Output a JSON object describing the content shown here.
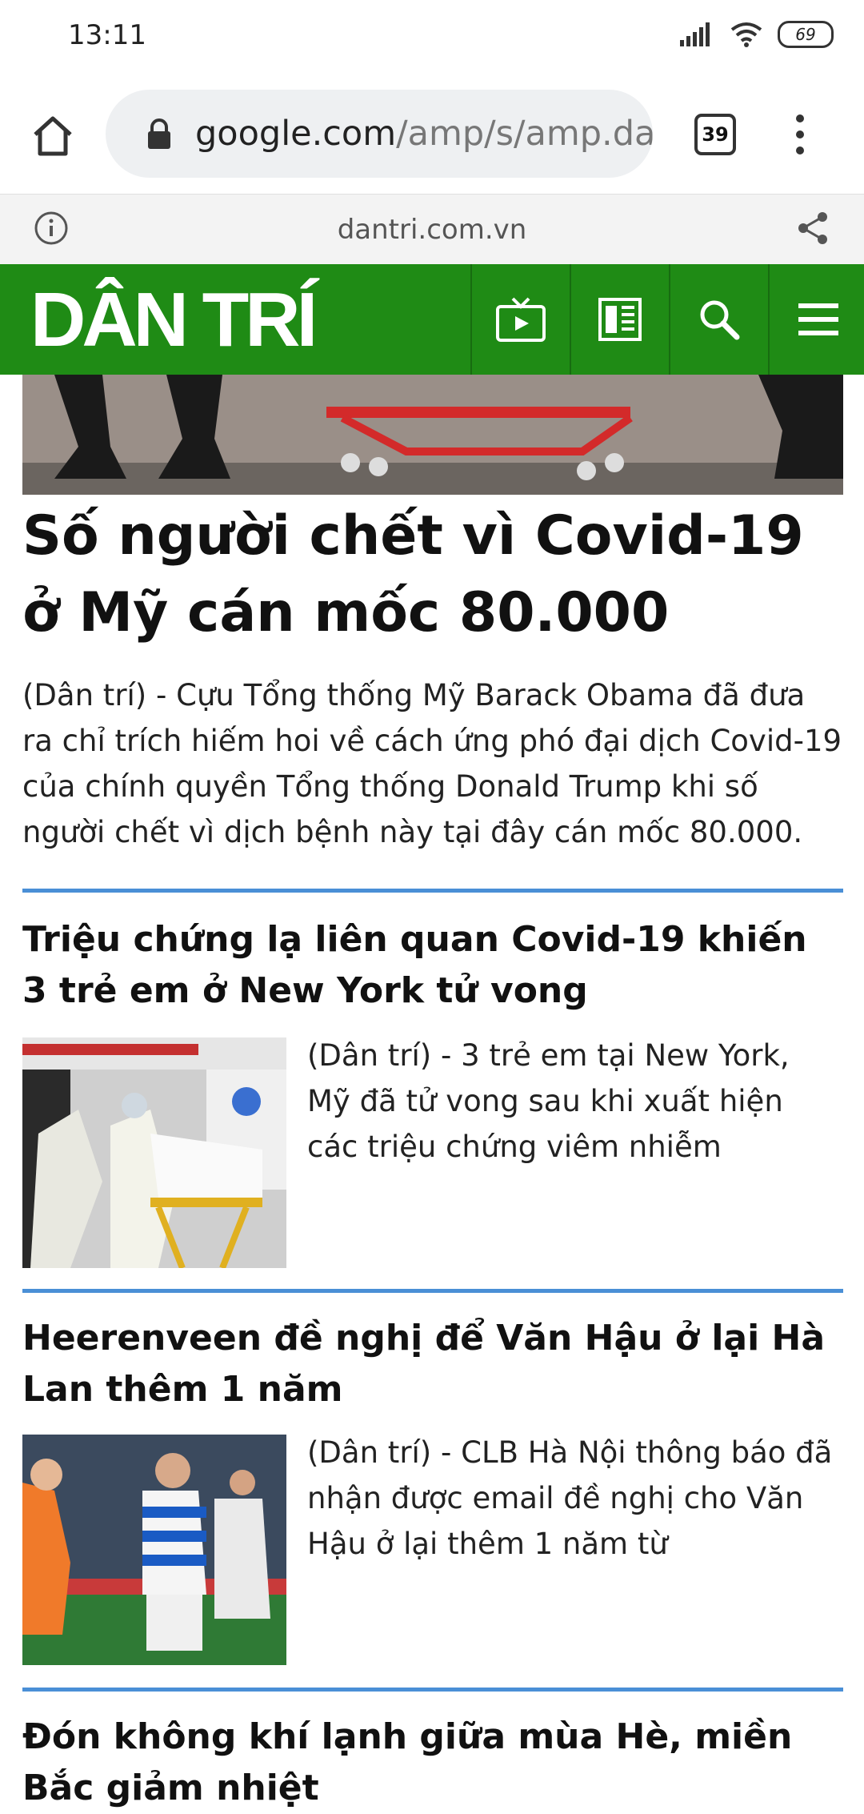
{
  "status_bar": {
    "time": "13:11",
    "battery": "69"
  },
  "browser": {
    "url_host": "google.com",
    "url_path": "/amp/s/amp.da",
    "tab_count": "39"
  },
  "amp_bar": {
    "domain": "dantri.com.vn"
  },
  "site": {
    "logo": "DÂN TRÍ"
  },
  "lead": {
    "title": "Số người chết vì Covid-19 ở Mỹ cán mốc 80.000",
    "summary": "(Dân trí) - Cựu Tổng thống Mỹ Barack Obama đã đưa ra chỉ trích hiếm hoi về cách ứng phó đại dịch Covid-19 của chính quyền Tổng thống Donald Trump khi số người chết vì dịch bệnh này tại đây cán mốc 80.000."
  },
  "articles": [
    {
      "title": "Triệu chứng lạ liên quan Covid-19 khiến 3 trẻ em ở New York tử vong",
      "summary": "(Dân trí) - 3 trẻ em tại New York, Mỹ đã tử vong sau khi xuất hiện các triệu chứng viêm nhiễm"
    },
    {
      "title": "Heerenveen đề nghị để Văn Hậu ở lại Hà Lan thêm 1 năm",
      "summary": "(Dân trí) - CLB Hà Nội thông báo đã nhận được email đề nghị cho Văn Hậu ở lại thêm 1 năm từ"
    },
    {
      "title": "Đón không khí lạnh giữa mùa Hè, miền Bắc giảm nhiệt"
    }
  ],
  "colors": {
    "brand_green": "#1f8b15",
    "divider_blue": "#4a8fd6"
  }
}
